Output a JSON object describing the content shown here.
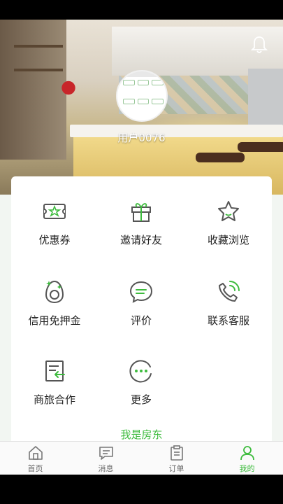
{
  "profile": {
    "username": "用户0076"
  },
  "menu": [
    {
      "label": "优惠券",
      "icon": "coupon-icon"
    },
    {
      "label": "邀请好友",
      "icon": "gift-icon"
    },
    {
      "label": "收藏浏览",
      "icon": "star-icon"
    },
    {
      "label": "信用免押金",
      "icon": "credit-egg-icon"
    },
    {
      "label": "评价",
      "icon": "comment-icon"
    },
    {
      "label": "联系客服",
      "icon": "phone-icon"
    },
    {
      "label": "商旅合作",
      "icon": "cooperation-icon"
    },
    {
      "label": "更多",
      "icon": "more-icon"
    }
  ],
  "landlord_link": "我是房东",
  "tabs": [
    {
      "label": "首页",
      "icon": "home-icon"
    },
    {
      "label": "消息",
      "icon": "message-icon"
    },
    {
      "label": "订单",
      "icon": "order-icon"
    },
    {
      "label": "我的",
      "icon": "user-icon",
      "active": true
    }
  ],
  "colors": {
    "accent": "#3dbb3d",
    "icon_gray": "#555555"
  }
}
